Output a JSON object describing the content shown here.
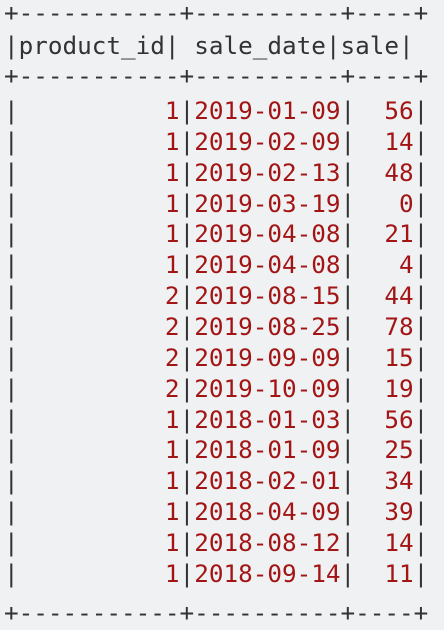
{
  "table": {
    "border_line": "+-----------+----------+----+",
    "columns": [
      "product_id",
      "sale_date",
      "sale"
    ],
    "rows": [
      [
        "1",
        "2019-01-09",
        "56"
      ],
      [
        "1",
        "2019-02-09",
        "14"
      ],
      [
        "1",
        "2019-02-13",
        "48"
      ],
      [
        "1",
        "2019-03-19",
        "0"
      ],
      [
        "1",
        "2019-04-08",
        "21"
      ],
      [
        "1",
        "2019-04-08",
        "4"
      ],
      [
        "2",
        "2019-08-15",
        "44"
      ],
      [
        "2",
        "2019-08-25",
        "78"
      ],
      [
        "2",
        "2019-09-09",
        "15"
      ],
      [
        "2",
        "2019-10-09",
        "19"
      ],
      [
        "1",
        "2018-01-03",
        "56"
      ],
      [
        "1",
        "2018-01-09",
        "25"
      ],
      [
        "1",
        "2018-02-01",
        "34"
      ],
      [
        "1",
        "2018-04-09",
        "39"
      ],
      [
        "1",
        "2018-08-12",
        "14"
      ],
      [
        "1",
        "2018-09-14",
        "11"
      ]
    ]
  },
  "colors": {
    "background": "#eff1f3",
    "text": "#333333",
    "value": "#a31515"
  }
}
